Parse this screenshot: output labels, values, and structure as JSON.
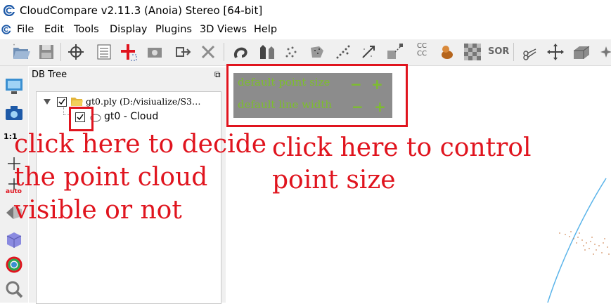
{
  "window": {
    "title": "CloudCompare v2.11.3 (Anoia) Stereo [64-bit]"
  },
  "menu": {
    "items": [
      "File",
      "Edit",
      "Tools",
      "Display",
      "Plugins",
      "3D Views",
      "Help"
    ]
  },
  "toolbar": {
    "icons": [
      "open-folder-icon",
      "save-icon",
      "clone-icon",
      "list-icon",
      "merge-icon",
      "segment-icon",
      "export-icon",
      "delete-icon",
      "sample-points-icon",
      "normal-icon",
      "subsample-icon",
      "density-icon",
      "noise-icon",
      "distance-icon",
      "registration-icon",
      "ccc-icon",
      "trunk-icon",
      "checker-icon",
      "sor-icon",
      "cut-icon",
      "translate-icon",
      "box-icon",
      "sparkle-icon"
    ],
    "sor_label": "SOR",
    "ccc_label": "CC CC"
  },
  "left_toolbar": {
    "zoom_label": "1:1",
    "auto_label": "auto"
  },
  "db_tree": {
    "title": "DB Tree",
    "root": {
      "label": "gt0.ply (D:/visiualize/S3…",
      "checked": true
    },
    "child": {
      "label": "gt0 - Cloud",
      "checked": true
    }
  },
  "overlay": {
    "point_size_label": "default point size",
    "line_width_label": "default line width",
    "minus_symbol": "−",
    "plus_symbol": "+"
  },
  "annotations": {
    "left_text": [
      "click here to decide",
      "the point cloud",
      "visible or not"
    ],
    "right_text": [
      "click here to control",
      "point size"
    ]
  },
  "colors": {
    "annotation_red": "#e0141e",
    "overlay_green": "#7dbe2d",
    "overlay_gray": "#8c8c8c",
    "globe_blue": "#5ab4ea"
  }
}
